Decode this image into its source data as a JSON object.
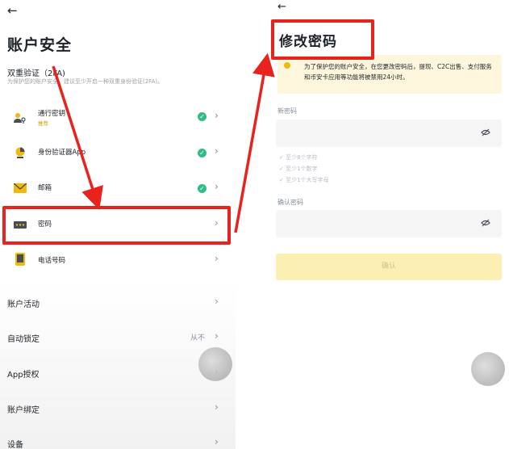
{
  "left": {
    "back_icon": "arrow-left-icon",
    "title": "账户安全",
    "tfa_title": "双重验证（2FA)",
    "tfa_desc": "为保护您的账户安全，建议至少开启一种双重身份验证(2FA)。",
    "security_items": [
      {
        "label": "通行密钥",
        "tag": "推荐",
        "icon": "passkey-icon",
        "enabled": true
      },
      {
        "label": "身份验证器App",
        "icon": "authenticator-icon",
        "enabled": true
      },
      {
        "label": "邮箱",
        "icon": "mail-icon",
        "enabled": true
      },
      {
        "label": "密码",
        "icon": "password-icon",
        "enabled": false
      },
      {
        "label": "电话号码",
        "icon": "phone-icon",
        "enabled": false
      }
    ],
    "menu_items": [
      {
        "label": "账户活动",
        "value": ""
      },
      {
        "label": "自动锁定",
        "value": "从不"
      },
      {
        "label": "App授权",
        "value": ""
      },
      {
        "label": "账户绑定",
        "value": ""
      },
      {
        "label": "设备",
        "value": ""
      }
    ]
  },
  "right": {
    "back_icon": "arrow-left-icon",
    "title": "修改密码",
    "notice": "为了保护您的账户安全，在您更改密码后，提现、C2C出售、支付服务和币安卡应用等功能将被禁用24小时。",
    "new_password_label": "新密码",
    "rules": [
      "至少8个字符",
      "至少1个数字",
      "至少1个大写字母"
    ],
    "confirm_password_label": "确认密码",
    "confirm_button": "确认"
  },
  "colors": {
    "highlight": "#e8221d",
    "success": "#2ebd85",
    "brand": "#f0b90b"
  }
}
